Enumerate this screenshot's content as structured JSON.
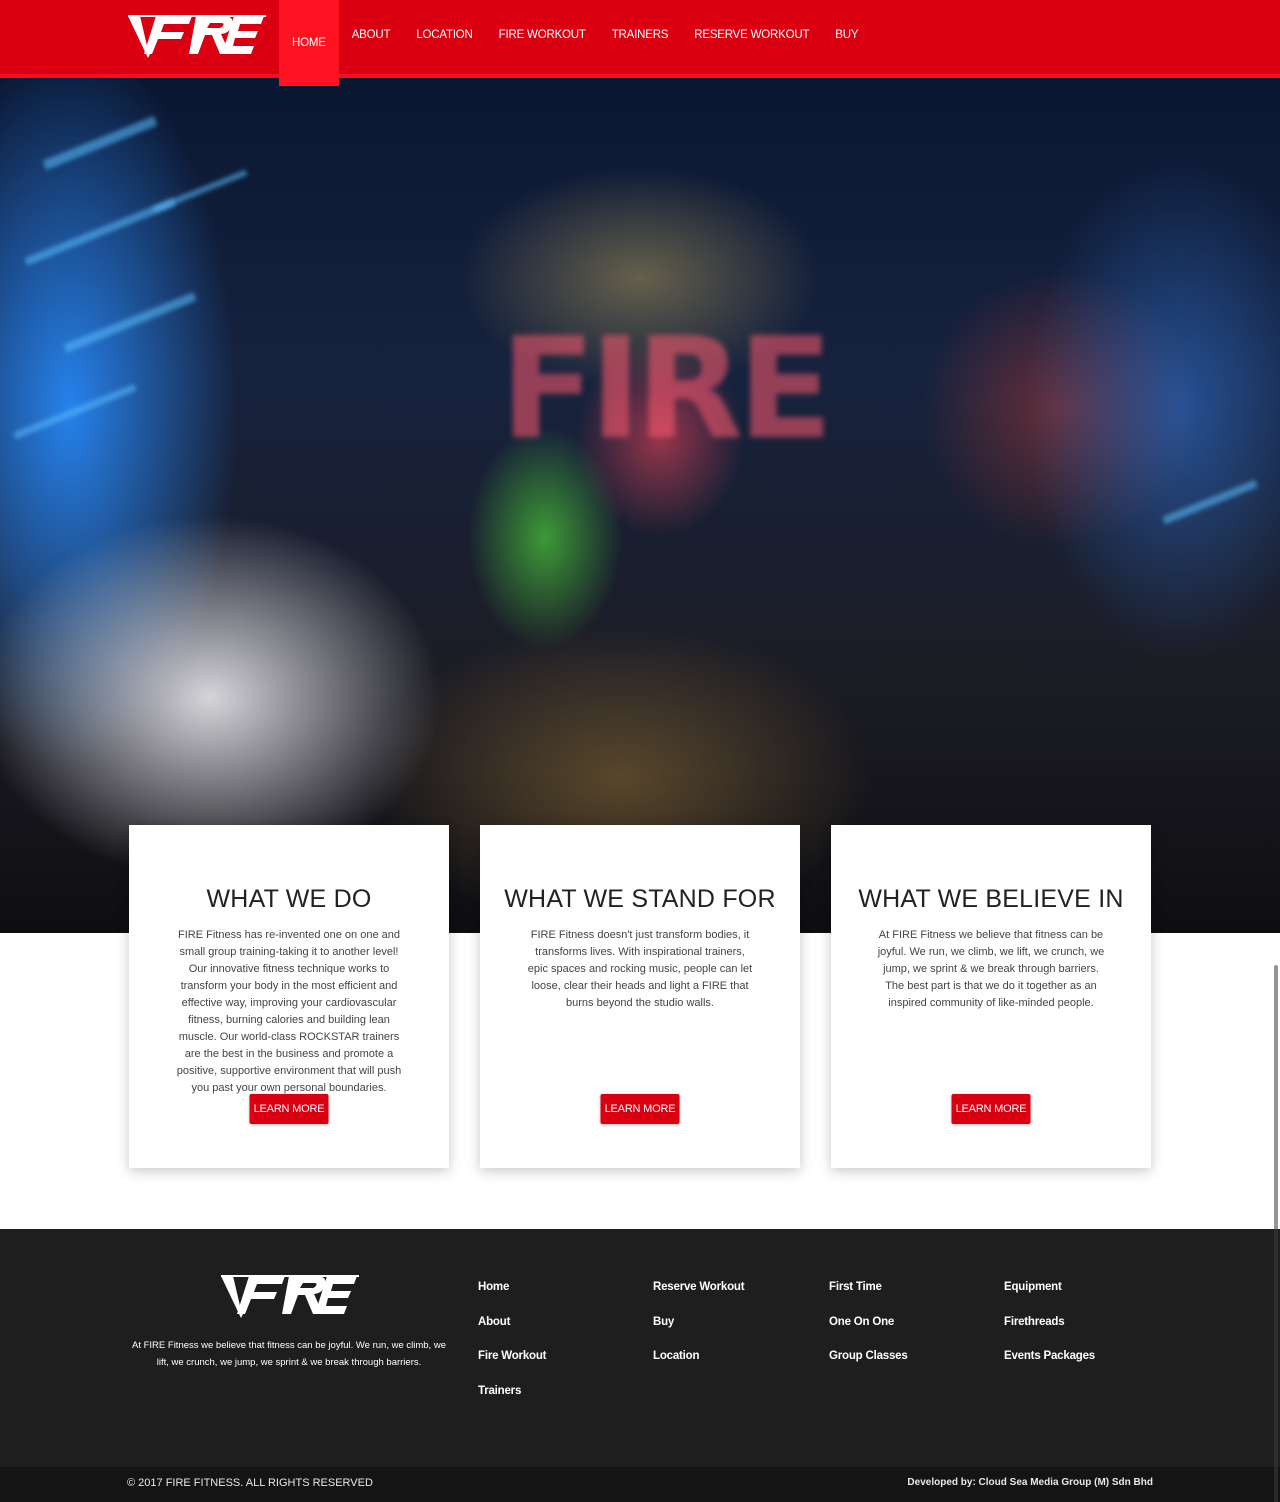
{
  "brand": {
    "logo_text": "FIRE"
  },
  "nav": {
    "items": [
      {
        "label": "HOME"
      },
      {
        "label": "ABOUT"
      },
      {
        "label": "LOCATION"
      },
      {
        "label": "FIRE WORKOUT"
      },
      {
        "label": "TRAINERS"
      },
      {
        "label": "RESERVE WORKOUT"
      },
      {
        "label": "BUY"
      }
    ],
    "active": "HOME"
  },
  "hero": {
    "sign_text": "FIRE"
  },
  "cards": [
    {
      "title": "WHAT WE DO",
      "text": "FIRE Fitness has re-invented one on one and small group training-taking it to another level! Our innovative fitness technique works to transform your body in the most efficient and effective way, improving your cardiovascular fitness, burning calories and building lean muscle. Our world-class ROCKSTAR trainers are the best in the business and promote a positive, supportive environment that will push you past your own personal boundaries.",
      "button": "LEARN MORE"
    },
    {
      "title": "WHAT WE STAND FOR",
      "text": "FIRE Fitness doesn't just transform bodies, it transforms lives. With inspirational trainers, epic spaces and rocking music, people can let loose, clear their heads and light a FIRE that burns beyond the studio walls.",
      "button": "LEARN MORE"
    },
    {
      "title": "WHAT WE BELIEVE IN",
      "text": "At FIRE Fitness we believe that fitness can be joyful. We run, we climb, we lift, we crunch, we jump, we sprint & we break through barriers. The best part is that we do it together as an inspired community of like-minded people.",
      "button": "LEARN MORE"
    }
  ],
  "footer": {
    "about": "At FIRE Fitness we believe that fitness can be joyful. We run, we climb, we lift, we crunch, we jump, we sprint & we break through barriers.",
    "columns": [
      [
        "Home",
        "About",
        "Fire Workout",
        "Trainers"
      ],
      [
        "Reserve Workout",
        "Buy",
        "Location"
      ],
      [
        "First Time",
        "One On One",
        "Group Classes"
      ],
      [
        "Equipment",
        "Firethreads",
        "Events Packages"
      ]
    ],
    "copyright": "© 2017 FIRE FITNESS. ALL RIGHTS RESERVED",
    "developer": "Developed by: Cloud Sea Media Group (M) Sdn Bhd"
  },
  "colors": {
    "brand_red": "#db0011",
    "active_red": "#ff1221",
    "footer_bg": "#1e1e1e",
    "bottom_bar_bg": "#141414"
  },
  "icons": {
    "logo": "fire-logo-icon"
  }
}
